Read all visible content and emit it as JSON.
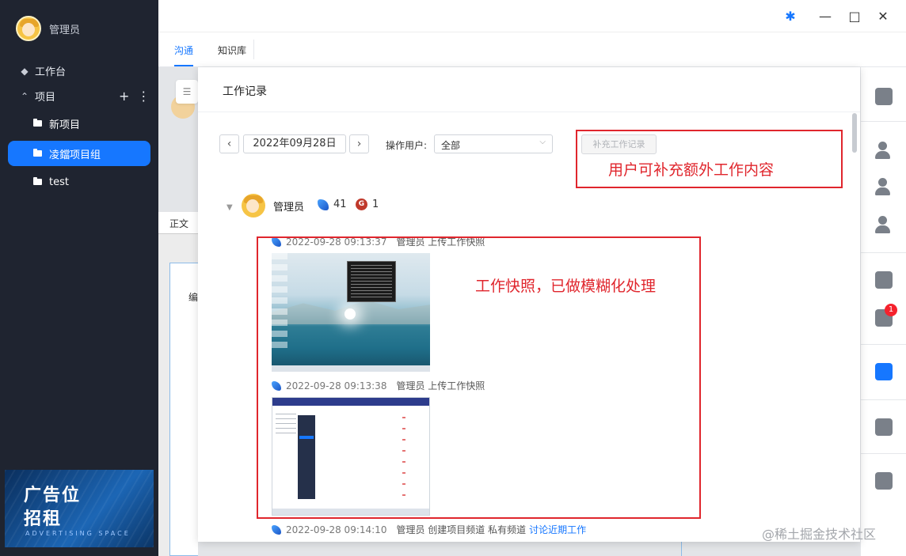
{
  "sidebar": {
    "user_name": "管理员",
    "workbench": "工作台",
    "projects": "项目",
    "items": [
      {
        "label": "新项目"
      },
      {
        "label": "凌鐺项目组"
      },
      {
        "label": "test"
      }
    ],
    "ad": {
      "line1": "广告位",
      "line2": "招租",
      "line3": "ADVERTISING SPACE"
    }
  },
  "tabs": [
    {
      "label": "沟通"
    },
    {
      "label": "知识库"
    }
  ],
  "background": {
    "strip_label": "正文",
    "doc_text": "编"
  },
  "modal": {
    "title": "工作记录",
    "date": "2022年09月28日",
    "filter_label": "操作用户:",
    "filter_value": "全部",
    "add_button": "补充工作记录",
    "user": {
      "name": "管理员",
      "stat_birds": "41",
      "stat_g": "1"
    },
    "records": [
      {
        "time": "2022-09-28 09:13:37",
        "text": "管理员 上传工作快照",
        "link": ""
      },
      {
        "time": "2022-09-28 09:13:38",
        "text": "管理员 上传工作快照",
        "link": ""
      },
      {
        "time": "2022-09-28 09:14:10",
        "text": "管理员 创建项目频道 私有频道",
        "link": "讨论近期工作"
      }
    ]
  },
  "annotations": {
    "add_note": "用户可补充额外工作内容",
    "snapshot_note": "工作快照，已做模糊化处理"
  },
  "rightbar": {
    "badge": "1"
  },
  "watermark": "@稀土掘金技术社区",
  "colors": {
    "accent": "#1677ff",
    "annotation": "#e0262d",
    "sidebar_bg": "#1f2430"
  }
}
